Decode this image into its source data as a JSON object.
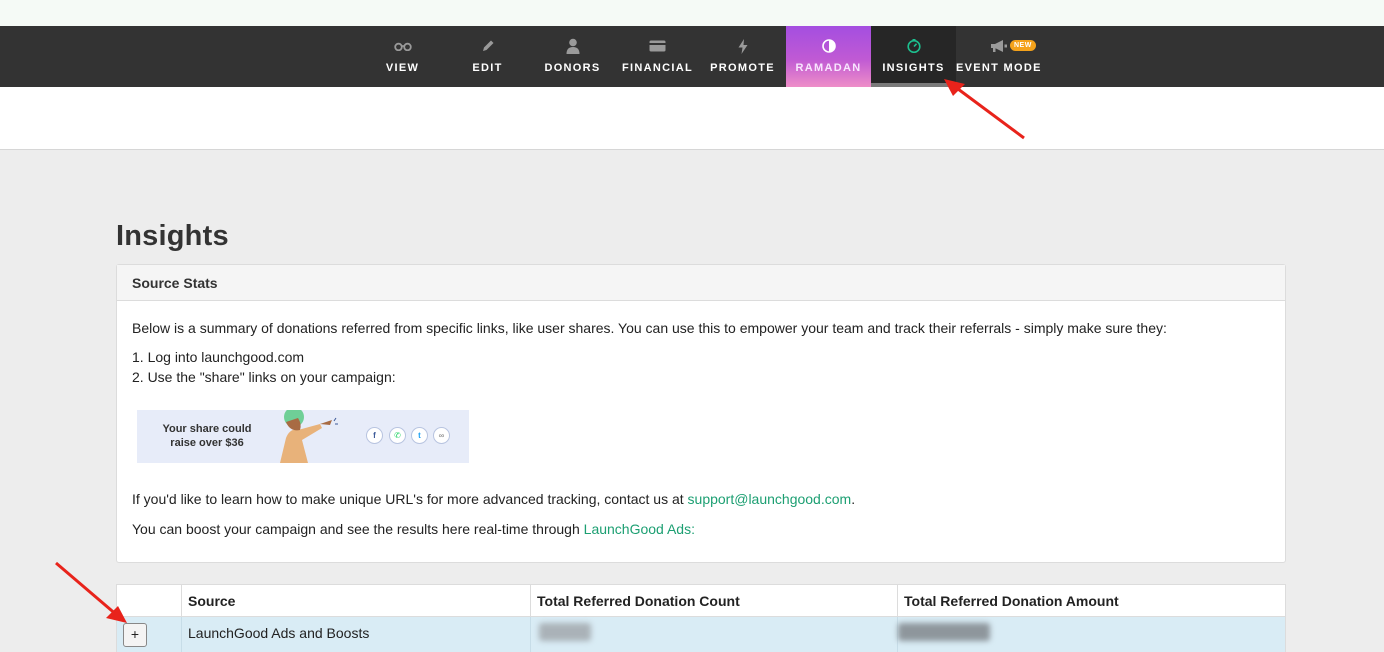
{
  "nav": {
    "items": [
      {
        "label": "VIEW",
        "icon": "glasses-icon"
      },
      {
        "label": "EDIT",
        "icon": "pencil-icon"
      },
      {
        "label": "DONORS",
        "icon": "person-icon"
      },
      {
        "label": "FINANCIAL",
        "icon": "credit-card-icon"
      },
      {
        "label": "PROMOTE",
        "icon": "lightning-icon"
      },
      {
        "label": "RAMADAN",
        "icon": "half-moon-icon"
      },
      {
        "label": "INSIGHTS",
        "icon": "gauge-icon",
        "active": true
      },
      {
        "label": "EVENT MODE",
        "icon": "megaphone-icon",
        "badge": "NEW"
      }
    ]
  },
  "page": {
    "title": "Insights"
  },
  "source_stats": {
    "heading": "Source Stats",
    "intro": "Below is a summary of donations referred from specific links, like user shares. You can use this to empower your team and track their referrals - simply make sure they:",
    "step1": "1. Log into launchgood.com",
    "step2": "2. Use the \"share\" links on your campaign:",
    "share_image_text_line1": "Your share could",
    "share_image_text_line2": "raise over $36",
    "share_icons": {
      "facebook": "f",
      "whatsapp": "✆",
      "twitter": "t",
      "link": "∞"
    },
    "tracking_prefix": "If you'd like to learn how to make unique URL's for more advanced tracking, contact us at ",
    "support_email": "support@launchgood.com",
    "tracking_suffix": ".",
    "boost_prefix": "You can boost your campaign and see the results here real-time through ",
    "ads_link": "LaunchGood Ads:"
  },
  "table": {
    "columns": [
      "",
      "Source",
      "Total Referred Donation Count",
      "Total Referred Donation Amount"
    ],
    "rows": [
      {
        "expand": "+",
        "source": "LaunchGood Ads and Boosts"
      }
    ]
  },
  "colors": {
    "accent_green": "#1c9f72",
    "nav_bg": "#333333",
    "row_highlight": "#d9ecf5",
    "badge": "#f4a21b"
  }
}
